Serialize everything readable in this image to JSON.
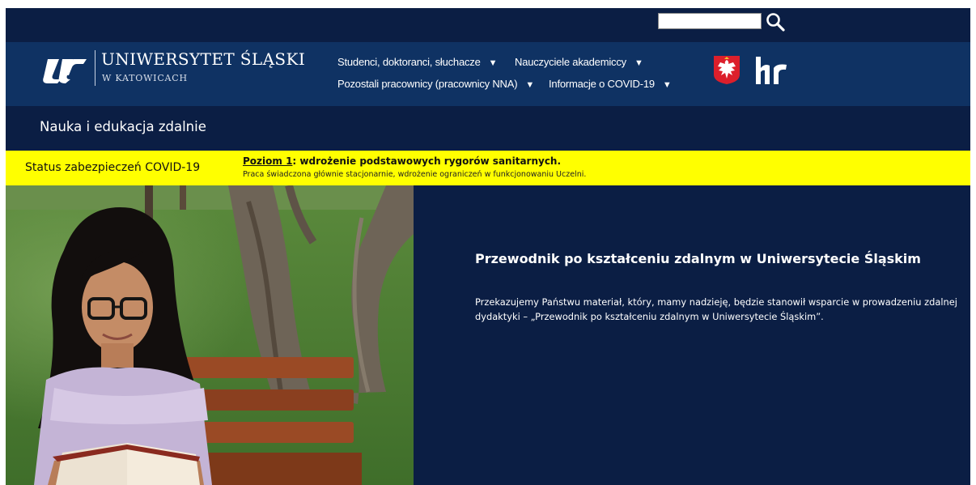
{
  "search": {
    "value": "",
    "placeholder": "",
    "button_icon": "magnifier-icon"
  },
  "header": {
    "logo_icon": "us-logo-icon",
    "university_name": "UNIWERSYTET ŚLĄSKI",
    "university_city": "W KATOWICACH",
    "nav": [
      {
        "label": "Studenci, doktoranci, słuchacze",
        "arrow": "▼"
      },
      {
        "label": "Nauczyciele akademiccy",
        "arrow": "▼"
      },
      {
        "label": "Pozostali pracownicy (pracownicy NNA)",
        "arrow": "▼"
      },
      {
        "label": "Informacje o COVID-19",
        "arrow": "▼"
      }
    ],
    "emblem_icon": "polish-eagle-emblem-icon",
    "hr_logo_icon": "hr-excellence-logo-icon"
  },
  "subheader": {
    "title": "Nauka i edukacja zdalnie"
  },
  "covid_banner": {
    "status_label": "Status zabezpieczeń COVID-19",
    "level_link": "Poziom 1",
    "level_text": ": wdrożenie podstawowych rygorów sanitarnych.",
    "description": "Praca świadczona głównie stacjonarnie, wdrożenie ograniczeń w funkcjonowaniu Uczelni.",
    "background_color": "#ffff00"
  },
  "hero": {
    "image_icon": "woman-reading-book-photo",
    "title": "Przewodnik po kształceniu zdalnym w Uniwersytecie Śląskim",
    "body": "Przekazujemy Państwu materiał, który, mamy nadzieję, będzie stanowił wsparcie w prowadzeniu zdalnej dydaktyki – „Przewodnik po kształceniu zdalnym w Uniwersytecie Śląskim”."
  },
  "colors": {
    "dark_navy": "#0b1e44",
    "header_blue": "#0f3263",
    "banner_yellow": "#ffff00"
  }
}
